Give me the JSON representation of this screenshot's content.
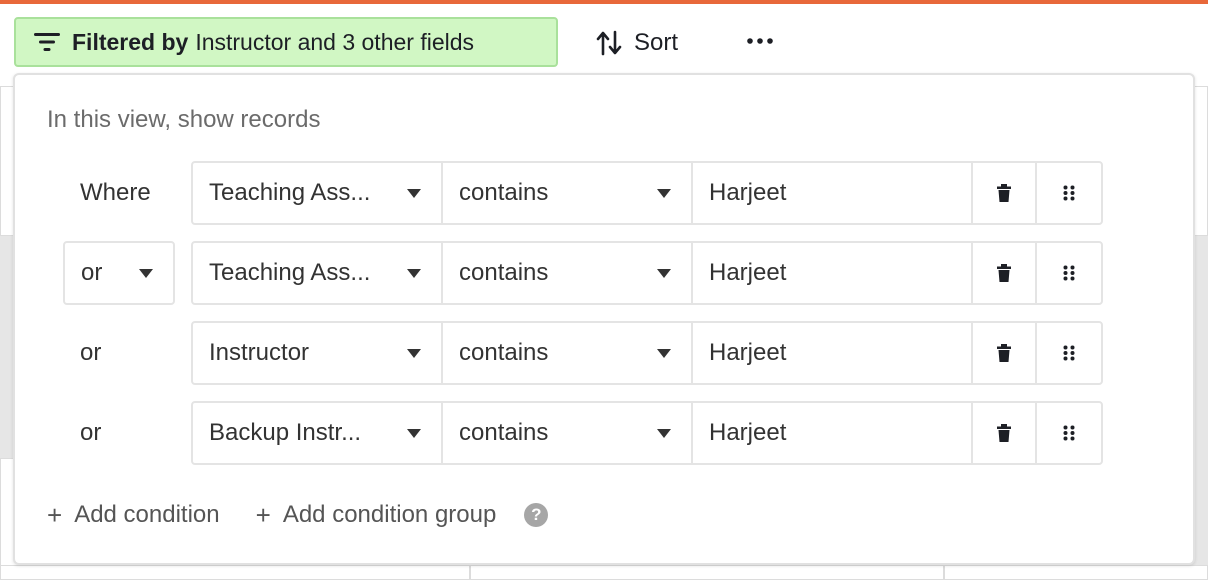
{
  "toolbar": {
    "filter_prefix": "Filtered by",
    "filter_suffix": "Instructor and 3 other fields",
    "sort_label": "Sort",
    "more_icon": "ellipsis-icon",
    "accent": "#d1f7c4"
  },
  "panel": {
    "title": "In this view, show records",
    "conditions": [
      {
        "conjunction": "Where",
        "field": "Teaching Ass...",
        "operator": "contains",
        "value": "Harjeet"
      },
      {
        "conjunction": "or",
        "field": "Teaching Ass...",
        "operator": "contains",
        "value": "Harjeet"
      },
      {
        "conjunction": "or",
        "field": "Instructor",
        "operator": "contains",
        "value": "Harjeet"
      },
      {
        "conjunction": "or",
        "field": "Backup Instr...",
        "operator": "contains",
        "value": "Harjeet"
      }
    ],
    "add_condition": "Add condition",
    "add_group": "Add condition group",
    "help_glyph": "?"
  }
}
